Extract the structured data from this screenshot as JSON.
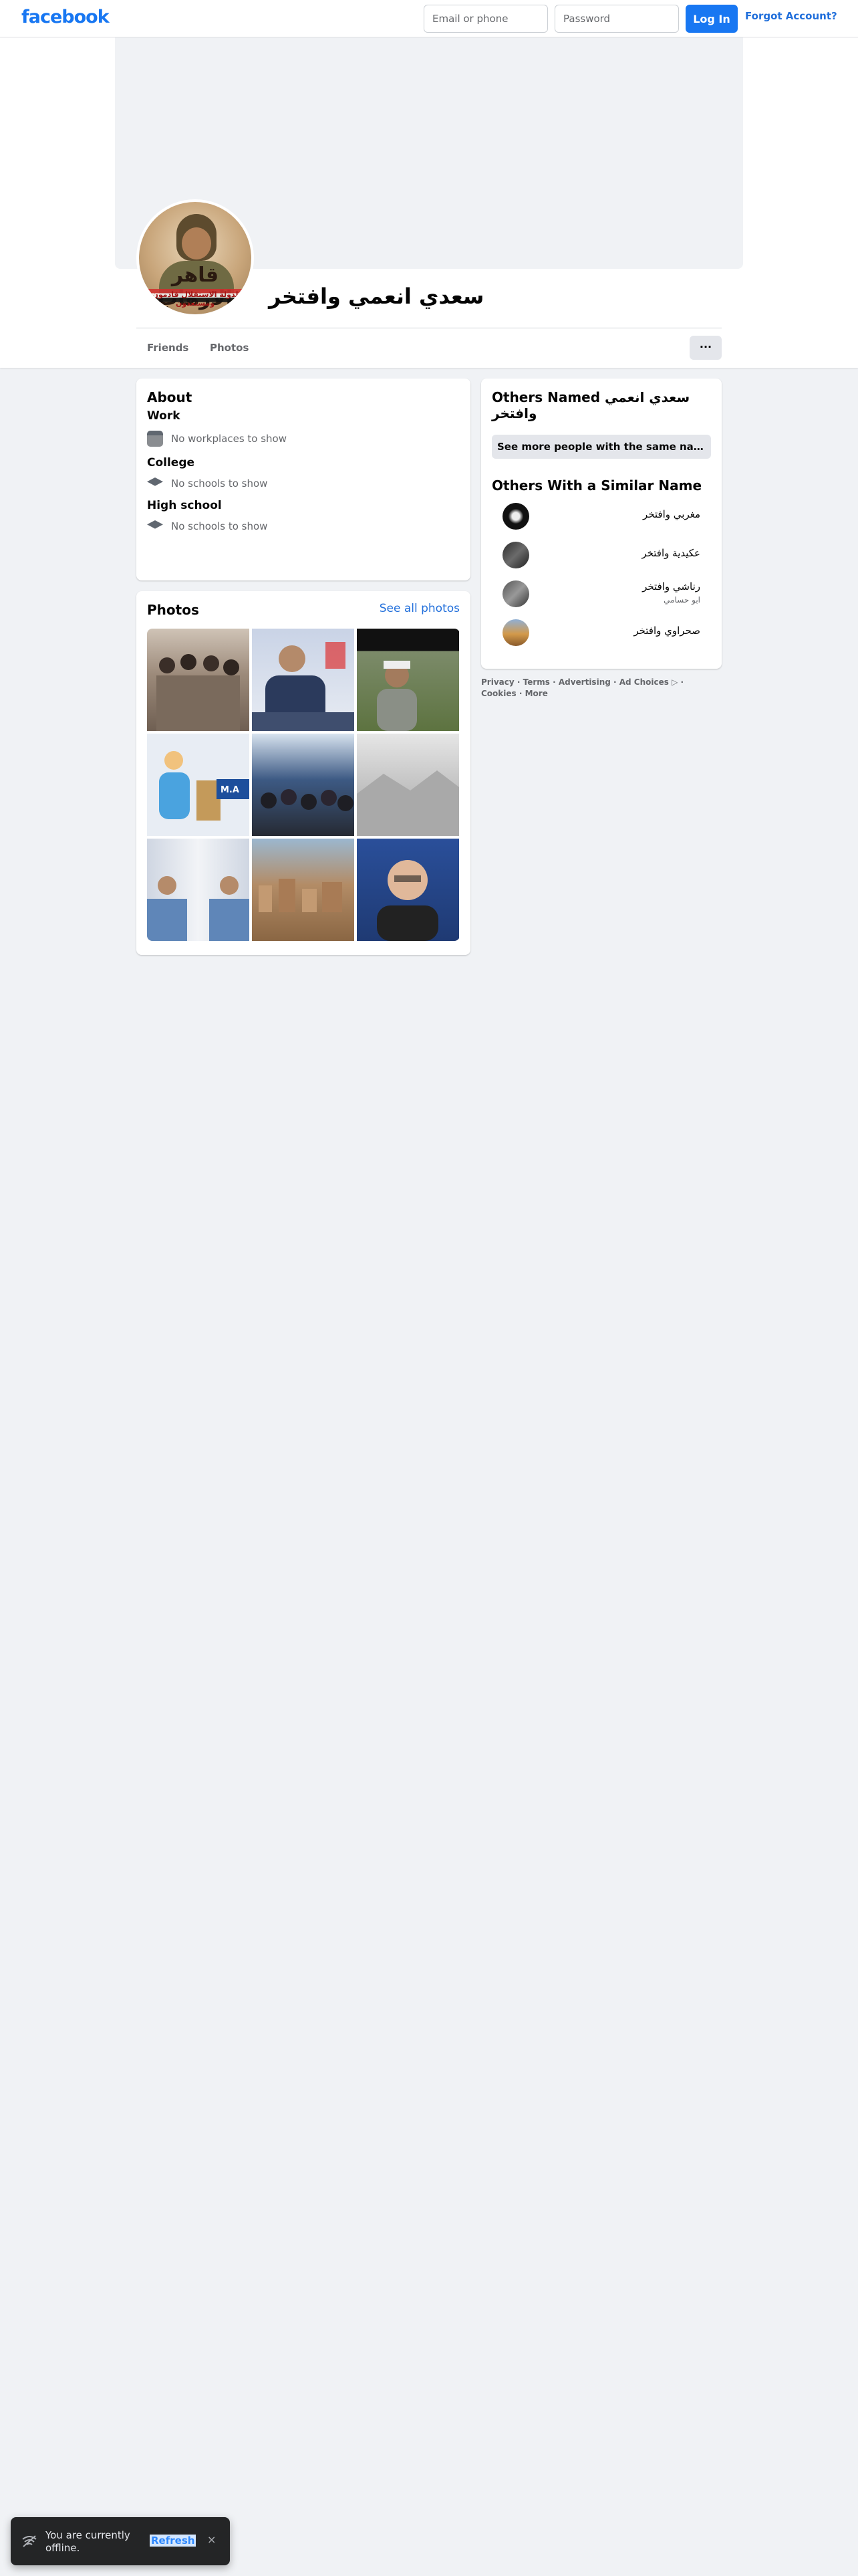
{
  "topbar": {
    "logo": "facebook",
    "email_placeholder": "Email or phone",
    "password_placeholder": "Password",
    "login_label": "Log In",
    "forgot_label": "Forgot Account?"
  },
  "profile": {
    "name": "سعدي انعمي وافتخر",
    "avatar_text": "قاهر الارهاب",
    "avatar_subtext": "لدولة الاستقلال قادمون ومستعدون",
    "tabs": [
      "Friends",
      "Photos"
    ],
    "more_label": "···"
  },
  "about": {
    "title": "About",
    "sections": [
      {
        "heading": "Work",
        "text": "No workplaces to show",
        "icon": "briefcase-icon"
      },
      {
        "heading": "College",
        "text": "No schools to show",
        "icon": "graduation-cap-icon"
      },
      {
        "heading": "High school",
        "text": "No schools to show",
        "icon": "graduation-cap-icon"
      }
    ]
  },
  "photos": {
    "title": "Photos",
    "see_all": "See all photos",
    "tile_labels": [
      "M.A"
    ]
  },
  "others": {
    "title": "Others Named سعدي انعمي وافتخر",
    "more_button": "See more people with the same name",
    "similar_title": "Others With a Similar Name",
    "people": [
      {
        "name": "مغربي وافتخر",
        "sub": ""
      },
      {
        "name": "عكيدية وافتخر",
        "sub": ""
      },
      {
        "name": "رناشي وافتخر",
        "sub": "ابو حسامي"
      },
      {
        "name": "صحراوي وافتخر",
        "sub": ""
      }
    ]
  },
  "footer": {
    "links": [
      "Privacy",
      "Terms",
      "Advertising",
      "Ad Choices",
      "Cookies",
      "More"
    ],
    "separator": " · "
  },
  "toast": {
    "message": "You are currently offline.",
    "refresh": "Refresh",
    "close": "×"
  },
  "colors": {
    "brand_blue": "#1877f2",
    "page_bg": "#f0f2f5",
    "link_blue": "#216fdb"
  }
}
